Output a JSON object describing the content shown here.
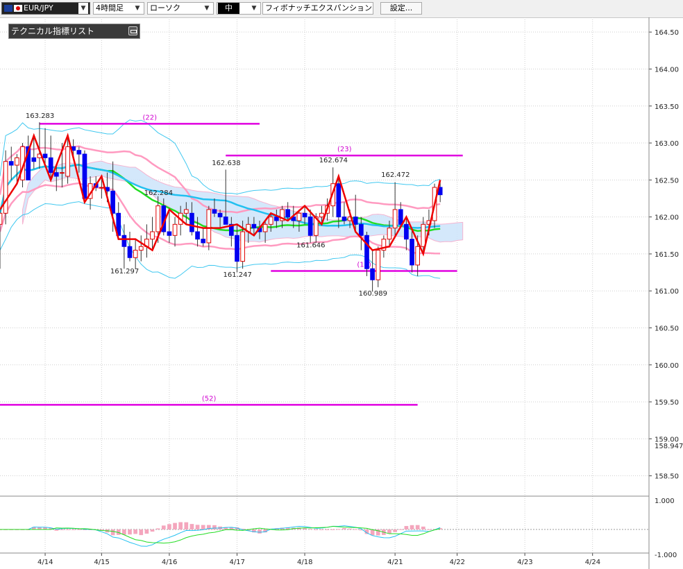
{
  "toolbar": {
    "symbol": "EUR/JPY",
    "period": "4時間足",
    "chart_type": "ローソク",
    "display": "中",
    "fibo": "フィボナッチエクスパンション",
    "settings_label": "設定..."
  },
  "indicator_panel": {
    "title": "テクニカル指標リスト"
  },
  "colors": {
    "up": "#e00000",
    "down": "#0000f0",
    "fib": "#e000e0",
    "bb_outer": "#40c8f0",
    "bb_inner": "#ff9ac0",
    "ma_green": "#22dd22",
    "ma_cyan": "#22c0f0",
    "zigzag": "#ee0000"
  },
  "chart_data": {
    "type": "candlestick",
    "series_name": "EUR/JPY",
    "timeframe": "4時間足",
    "y_range": [
      158.3,
      164.68
    ],
    "y_ticks": [
      "164.50",
      "164.00",
      "163.50",
      "163.00",
      "162.50",
      "162.00",
      "161.50",
      "161.00",
      "160.50",
      "160.00",
      "159.50",
      "159.00",
      "158.50"
    ],
    "y_current_label": "158.947",
    "x_range": [
      0,
      115
    ],
    "x_ticks": [
      {
        "label": "4/14",
        "x": 8
      },
      {
        "label": "4/15",
        "x": 18
      },
      {
        "label": "4/16",
        "x": 30
      },
      {
        "label": "4/17",
        "x": 42
      },
      {
        "label": "4/18",
        "x": 54
      },
      {
        "label": "4/21",
        "x": 70
      },
      {
        "label": "4/22",
        "x": 81
      },
      {
        "label": "4/23",
        "x": 93
      },
      {
        "label": "4/24",
        "x": 105
      }
    ],
    "grid": true,
    "candles": [
      {
        "x": 0,
        "o": 161.9,
        "h": 162.1,
        "l": 161.3,
        "c": 162.05
      },
      {
        "x": 1,
        "o": 162.05,
        "h": 162.9,
        "l": 161.9,
        "c": 162.75
      },
      {
        "x": 2,
        "o": 162.75,
        "h": 162.95,
        "l": 162.5,
        "c": 162.7
      },
      {
        "x": 3,
        "o": 162.7,
        "h": 162.85,
        "l": 162.45,
        "c": 162.8
      },
      {
        "x": 4,
        "o": 162.5,
        "h": 163.0,
        "l": 162.4,
        "c": 162.95
      },
      {
        "x": 5,
        "o": 162.95,
        "h": 163.1,
        "l": 162.5,
        "c": 162.5
      },
      {
        "x": 6,
        "o": 162.8,
        "h": 163.1,
        "l": 162.65,
        "c": 162.75
      },
      {
        "x": 7,
        "o": 162.8,
        "h": 163.28,
        "l": 162.65,
        "c": 162.85
      },
      {
        "x": 8,
        "o": 162.85,
        "h": 163.2,
        "l": 162.7,
        "c": 162.8
      },
      {
        "x": 9,
        "o": 162.8,
        "h": 163.1,
        "l": 162.5,
        "c": 162.6
      },
      {
        "x": 10,
        "o": 162.6,
        "h": 162.7,
        "l": 162.35,
        "c": 162.55
      },
      {
        "x": 11,
        "o": 162.6,
        "h": 163.0,
        "l": 162.4,
        "c": 162.6
      },
      {
        "x": 12,
        "o": 162.55,
        "h": 163.1,
        "l": 162.45,
        "c": 162.95
      },
      {
        "x": 13,
        "o": 162.95,
        "h": 163.05,
        "l": 162.8,
        "c": 162.9
      },
      {
        "x": 14,
        "o": 162.9,
        "h": 162.95,
        "l": 162.6,
        "c": 162.85
      },
      {
        "x": 15,
        "o": 162.85,
        "h": 162.9,
        "l": 162.2,
        "c": 162.25
      },
      {
        "x": 16,
        "o": 162.25,
        "h": 162.55,
        "l": 162.1,
        "c": 162.45
      },
      {
        "x": 17,
        "o": 162.45,
        "h": 162.55,
        "l": 162.35,
        "c": 162.4
      },
      {
        "x": 18,
        "o": 162.4,
        "h": 162.55,
        "l": 162.25,
        "c": 162.4
      },
      {
        "x": 19,
        "o": 162.4,
        "h": 162.6,
        "l": 162.2,
        "c": 162.35
      },
      {
        "x": 20,
        "o": 162.35,
        "h": 162.75,
        "l": 161.8,
        "c": 162.05
      },
      {
        "x": 21,
        "o": 162.05,
        "h": 162.2,
        "l": 161.7,
        "c": 161.75
      },
      {
        "x": 22,
        "o": 161.75,
        "h": 161.9,
        "l": 161.3,
        "c": 161.6
      },
      {
        "x": 23,
        "o": 161.6,
        "h": 161.8,
        "l": 161.4,
        "c": 161.45
      },
      {
        "x": 24,
        "o": 161.45,
        "h": 161.7,
        "l": 161.3,
        "c": 161.55
      },
      {
        "x": 25,
        "o": 161.55,
        "h": 161.75,
        "l": 161.4,
        "c": 161.6
      },
      {
        "x": 26,
        "o": 161.6,
        "h": 161.9,
        "l": 161.45,
        "c": 161.7
      },
      {
        "x": 27,
        "o": 161.7,
        "h": 162.0,
        "l": 161.55,
        "c": 161.8
      },
      {
        "x": 28,
        "o": 161.8,
        "h": 162.28,
        "l": 161.65,
        "c": 162.15
      },
      {
        "x": 29,
        "o": 162.15,
        "h": 162.25,
        "l": 161.75,
        "c": 161.8
      },
      {
        "x": 30,
        "o": 161.8,
        "h": 162.1,
        "l": 161.65,
        "c": 161.75
      },
      {
        "x": 31,
        "o": 161.75,
        "h": 162.0,
        "l": 161.6,
        "c": 161.9
      },
      {
        "x": 32,
        "o": 161.9,
        "h": 162.15,
        "l": 161.75,
        "c": 162.05
      },
      {
        "x": 33,
        "o": 162.05,
        "h": 162.2,
        "l": 161.9,
        "c": 162.1
      },
      {
        "x": 34,
        "o": 162.05,
        "h": 162.2,
        "l": 161.75,
        "c": 161.8
      },
      {
        "x": 35,
        "o": 161.8,
        "h": 162.0,
        "l": 161.6,
        "c": 161.7
      },
      {
        "x": 36,
        "o": 161.7,
        "h": 161.85,
        "l": 161.6,
        "c": 161.65
      },
      {
        "x": 37,
        "o": 161.65,
        "h": 162.15,
        "l": 161.55,
        "c": 162.1
      },
      {
        "x": 38,
        "o": 162.1,
        "h": 162.25,
        "l": 162.0,
        "c": 162.05
      },
      {
        "x": 39,
        "o": 162.05,
        "h": 162.1,
        "l": 161.85,
        "c": 162.0
      },
      {
        "x": 40,
        "o": 162.0,
        "h": 162.64,
        "l": 161.9,
        "c": 161.9
      },
      {
        "x": 41,
        "o": 161.9,
        "h": 162.0,
        "l": 161.6,
        "c": 161.75
      },
      {
        "x": 42,
        "o": 161.75,
        "h": 161.9,
        "l": 161.25,
        "c": 161.4
      },
      {
        "x": 43,
        "o": 161.4,
        "h": 161.95,
        "l": 161.3,
        "c": 161.8
      },
      {
        "x": 44,
        "o": 161.8,
        "h": 162.0,
        "l": 161.65,
        "c": 161.9
      },
      {
        "x": 45,
        "o": 161.9,
        "h": 162.0,
        "l": 161.75,
        "c": 161.85
      },
      {
        "x": 46,
        "o": 161.85,
        "h": 161.95,
        "l": 161.7,
        "c": 161.8
      },
      {
        "x": 47,
        "o": 161.8,
        "h": 161.95,
        "l": 161.65,
        "c": 161.9
      },
      {
        "x": 48,
        "o": 161.9,
        "h": 162.05,
        "l": 161.8,
        "c": 162.0
      },
      {
        "x": 49,
        "o": 162.0,
        "h": 162.1,
        "l": 161.85,
        "c": 161.95
      },
      {
        "x": 50,
        "o": 161.95,
        "h": 162.15,
        "l": 161.85,
        "c": 162.1
      },
      {
        "x": 51,
        "o": 162.1,
        "h": 162.2,
        "l": 161.95,
        "c": 162.0
      },
      {
        "x": 52,
        "o": 162.0,
        "h": 162.15,
        "l": 161.85,
        "c": 161.95
      },
      {
        "x": 53,
        "o": 161.95,
        "h": 162.1,
        "l": 161.8,
        "c": 162.05
      },
      {
        "x": 54,
        "o": 162.05,
        "h": 162.15,
        "l": 161.9,
        "c": 162.0
      },
      {
        "x": 55,
        "o": 162.0,
        "h": 162.1,
        "l": 161.65,
        "c": 161.75
      },
      {
        "x": 56,
        "o": 161.75,
        "h": 162.05,
        "l": 161.65,
        "c": 162.0
      },
      {
        "x": 57,
        "o": 162.0,
        "h": 162.15,
        "l": 161.9,
        "c": 162.05
      },
      {
        "x": 58,
        "o": 162.05,
        "h": 162.25,
        "l": 161.95,
        "c": 162.15
      },
      {
        "x": 59,
        "o": 162.15,
        "h": 162.67,
        "l": 162.0,
        "c": 162.45
      },
      {
        "x": 60,
        "o": 162.45,
        "h": 162.55,
        "l": 161.85,
        "c": 162.0
      },
      {
        "x": 61,
        "o": 162.0,
        "h": 162.2,
        "l": 161.9,
        "c": 161.95
      },
      {
        "x": 62,
        "o": 161.95,
        "h": 162.1,
        "l": 161.85,
        "c": 162.0
      },
      {
        "x": 63,
        "o": 162.0,
        "h": 162.3,
        "l": 161.8,
        "c": 161.9
      },
      {
        "x": 64,
        "o": 161.9,
        "h": 162.0,
        "l": 161.55,
        "c": 161.75
      },
      {
        "x": 65,
        "o": 161.75,
        "h": 161.8,
        "l": 161.2,
        "c": 161.3
      },
      {
        "x": 66,
        "o": 161.3,
        "h": 161.55,
        "l": 160.99,
        "c": 161.15
      },
      {
        "x": 67,
        "o": 161.15,
        "h": 161.6,
        "l": 161.05,
        "c": 161.55
      },
      {
        "x": 68,
        "o": 161.55,
        "h": 161.75,
        "l": 161.45,
        "c": 161.7
      },
      {
        "x": 69,
        "o": 161.7,
        "h": 161.95,
        "l": 161.6,
        "c": 161.85
      },
      {
        "x": 70,
        "o": 161.85,
        "h": 162.47,
        "l": 161.75,
        "c": 162.1
      },
      {
        "x": 71,
        "o": 162.1,
        "h": 162.2,
        "l": 161.85,
        "c": 161.9
      },
      {
        "x": 72,
        "o": 161.9,
        "h": 162.0,
        "l": 161.55,
        "c": 161.7
      },
      {
        "x": 73,
        "o": 161.7,
        "h": 161.85,
        "l": 161.25,
        "c": 161.35
      },
      {
        "x": 74,
        "o": 161.35,
        "h": 161.75,
        "l": 161.2,
        "c": 161.6
      },
      {
        "x": 75,
        "o": 161.6,
        "h": 162.0,
        "l": 161.5,
        "c": 161.9
      },
      {
        "x": 76,
        "o": 161.9,
        "h": 162.1,
        "l": 161.75,
        "c": 161.95
      },
      {
        "x": 77,
        "o": 161.95,
        "h": 162.45,
        "l": 161.85,
        "c": 162.4
      },
      {
        "x": 78,
        "o": 162.4,
        "h": 162.5,
        "l": 162.2,
        "c": 162.3
      }
    ],
    "annotations": [
      {
        "text": "163.283",
        "x": 7,
        "y": 163.32
      },
      {
        "text": "162.638",
        "x": 40,
        "y": 162.68
      },
      {
        "text": "162.674",
        "x": 59,
        "y": 162.72
      },
      {
        "text": "162.472",
        "x": 70,
        "y": 162.52
      },
      {
        "text": "162.284",
        "x": 28,
        "y": 162.28
      },
      {
        "text": "161.297",
        "x": 22,
        "y": 161.22
      },
      {
        "text": "161.247",
        "x": 42,
        "y": 161.17
      },
      {
        "text": "161.646",
        "x": 55,
        "y": 161.57
      },
      {
        "text": "160.989",
        "x": 66,
        "y": 160.92
      }
    ],
    "fib_levels": [
      {
        "label": "(22)",
        "y": 163.26,
        "x1": 7,
        "x2": 46
      },
      {
        "label": "(23)",
        "y": 162.83,
        "x1": 40,
        "x2": 82
      },
      {
        "label": "(18)",
        "y": 161.27,
        "x1": 48,
        "x2": 81
      },
      {
        "label": "(52)",
        "y": 159.46,
        "x1": 0,
        "x2": 74
      }
    ]
  },
  "macd_panel": {
    "y_ticks": [
      "1.000",
      "-1.000"
    ],
    "zero_line": "0"
  }
}
